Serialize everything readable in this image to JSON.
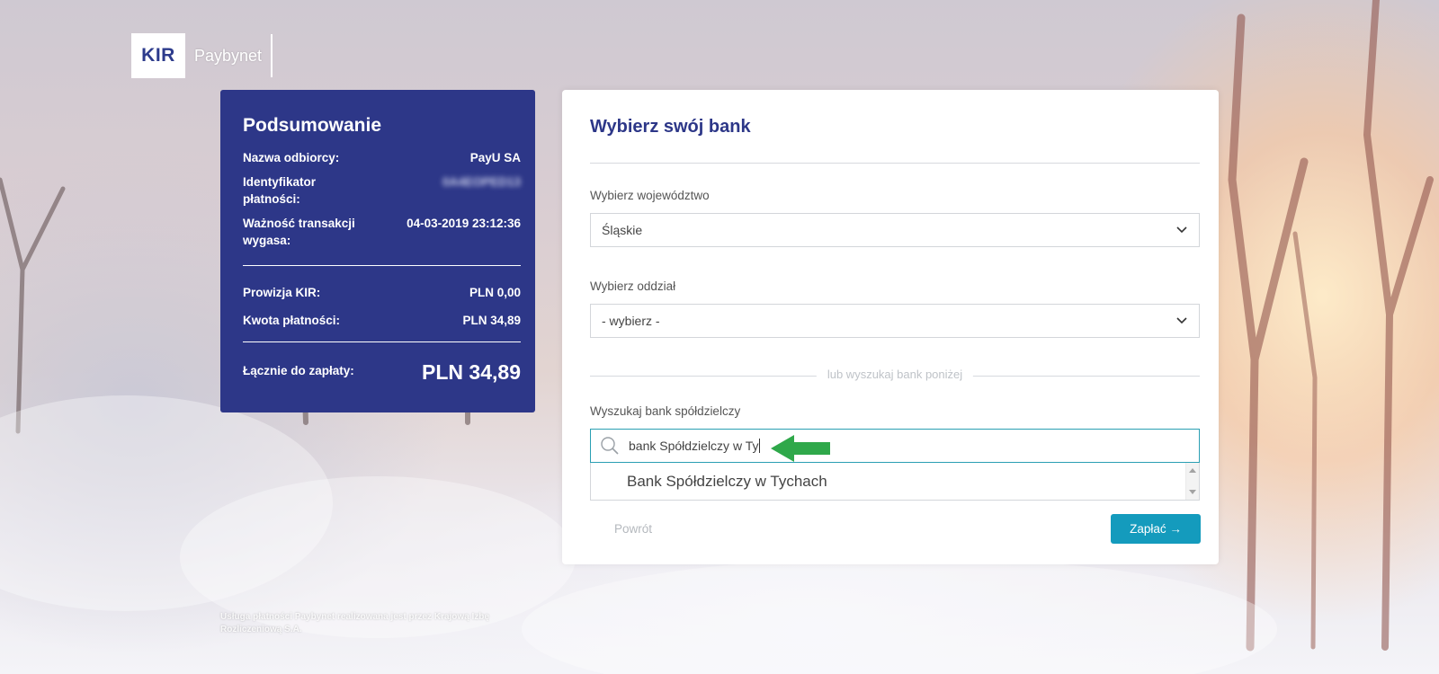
{
  "logo": {
    "mark": "KIR",
    "name": "Paybynet"
  },
  "summary": {
    "title": "Podsumowanie",
    "rows": [
      {
        "label": "Nazwa odbiorcy:",
        "value": "PayU SA"
      },
      {
        "label": "Identyfikator płatności:",
        "value": "0A4EOPED13"
      },
      {
        "label": "Ważność transakcji wygasa:",
        "value": "04-03-2019 23:12:36"
      }
    ],
    "fees": [
      {
        "label": "Prowizja KIR:",
        "value": "PLN 0,00"
      },
      {
        "label": "Kwota płatności:",
        "value": "PLN 34,89"
      }
    ],
    "total_label": "Łącznie do zapłaty:",
    "total_value": "PLN 34,89"
  },
  "bank_form": {
    "title": "Wybierz swój bank",
    "region_label": "Wybierz województwo",
    "region_value": "Śląskie",
    "branch_label": "Wybierz oddział",
    "branch_value": "- wybierz -",
    "or_text": "lub wyszukaj bank poniżej",
    "search_label": "Wyszukaj bank spółdzielczy",
    "search_value": "bank Spółdzielczy w Ty",
    "suggestion": "Bank Spółdzielczy w Tychach",
    "back_label": "Powrót",
    "pay_label": "Zapłać →"
  },
  "footer": {
    "text": "Usługa płatności Paybynet realizowana jest przez Krajową Izbę Rozliczeniową S.A."
  },
  "colors": {
    "navy": "#2d3788",
    "accent": "#149bbd",
    "arrow": "#2fa84a"
  },
  "icons": [
    "search-icon",
    "chevron-down-icon",
    "arrow-annotation-icon"
  ]
}
